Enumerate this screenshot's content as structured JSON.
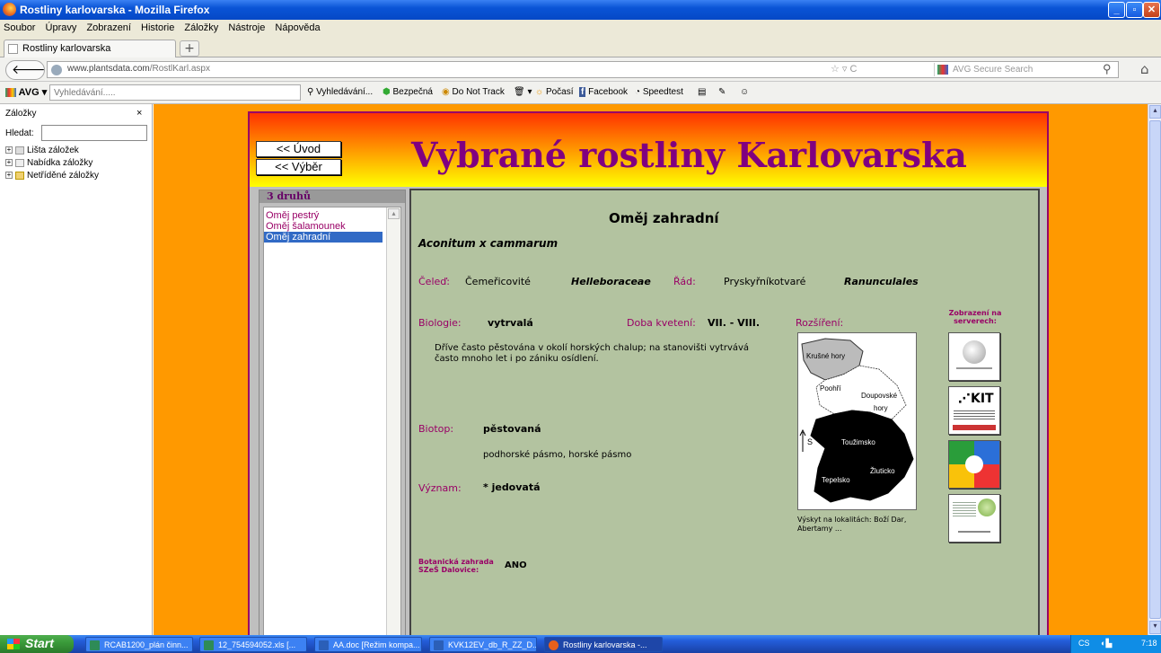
{
  "window": {
    "title": "Rostliny karlovarska - Mozilla Firefox"
  },
  "menu": [
    "Soubor",
    "Úpravy",
    "Zobrazení",
    "Historie",
    "Záložky",
    "Nástroje",
    "Nápověda"
  ],
  "tab": {
    "label": "Rostliny karlovarska",
    "new_tab": "+"
  },
  "nav": {
    "url_host": "www.plantsdata.com",
    "url_path": "/RostlKarl.aspx",
    "search_placeholder": "AVG Secure Search"
  },
  "avg": {
    "brand": "AVG",
    "search_placeholder": "Vyhledávání.....",
    "items": [
      "Vyhledávání...",
      "Bezpečná",
      "Do Not Track",
      "Počasí",
      "Facebook",
      "Speedtest"
    ]
  },
  "sidebar": {
    "title": "Záložky",
    "close": "×",
    "search_label": "Hledat:",
    "items": [
      "Lišta záložek",
      "Nabídka záložky",
      "Netříděné záložky"
    ]
  },
  "site": {
    "title": "Vybrané rostliny Karlovarska",
    "btn_uvod": "<< Úvod",
    "btn_vyber": "<< Výběr",
    "list_header": "3 druhů",
    "list": [
      "Oměj pestrý",
      "Oměj šalamounek",
      "Oměj zahradní"
    ],
    "selected_index": 2
  },
  "plant": {
    "name": "Oměj zahradní",
    "latin": "Aconitum x cammarum",
    "celed_label": "Čeleď:",
    "celed": "Čemeřicovité",
    "celed_latin": "Helleboraceae",
    "rad_label": "Řád:",
    "rad": "Pryskyřníkotvaré",
    "rad_latin": "Ranunculales",
    "biologie_label": "Biologie:",
    "biologie": "vytrvalá",
    "kveteni_label": "Doba kvetení:",
    "kveteni": "VII. - VIII.",
    "rozsireni_label": "Rozšíření:",
    "popis_1": "Dříve často pěstována v okolí horských chalup; na stanovišti vytrvává",
    "popis_2": "často mnoho let i po zániku osídlení.",
    "biotop_label": "Biotop:",
    "biotop": "pěstovaná",
    "pasmo": "podhorské pásmo, horské pásmo",
    "vyznam_label": "Význam:",
    "vyznam": "* jedovatá",
    "zahrada_label_1": "Botanická zahrada",
    "zahrada_label_2": "SZeŠ Dalovice:",
    "zahrada": "ANO",
    "vyskyt_1": "Výskyt na lokalitách: Boží Dar,",
    "vyskyt_2": "Abertamy ...",
    "servery_1": "Zobrazení na",
    "servery_2": "serverech:"
  },
  "map": {
    "regions": [
      "Krušné hory",
      "Poohří",
      "Doupovské",
      "hory",
      "Toužimsko",
      "Žluticko",
      "Tepelsko"
    ],
    "north": "S"
  },
  "taskbar": {
    "start": "Start",
    "tasks": [
      "RCAB1200_plán činn...",
      "12_754594052.xls [...",
      "AA.doc [Režim kompa...",
      "KVK12EV_db_R_ZZ_D...",
      "Rostliny karlovarska -..."
    ],
    "lang": "CS",
    "clock": "7:18"
  }
}
